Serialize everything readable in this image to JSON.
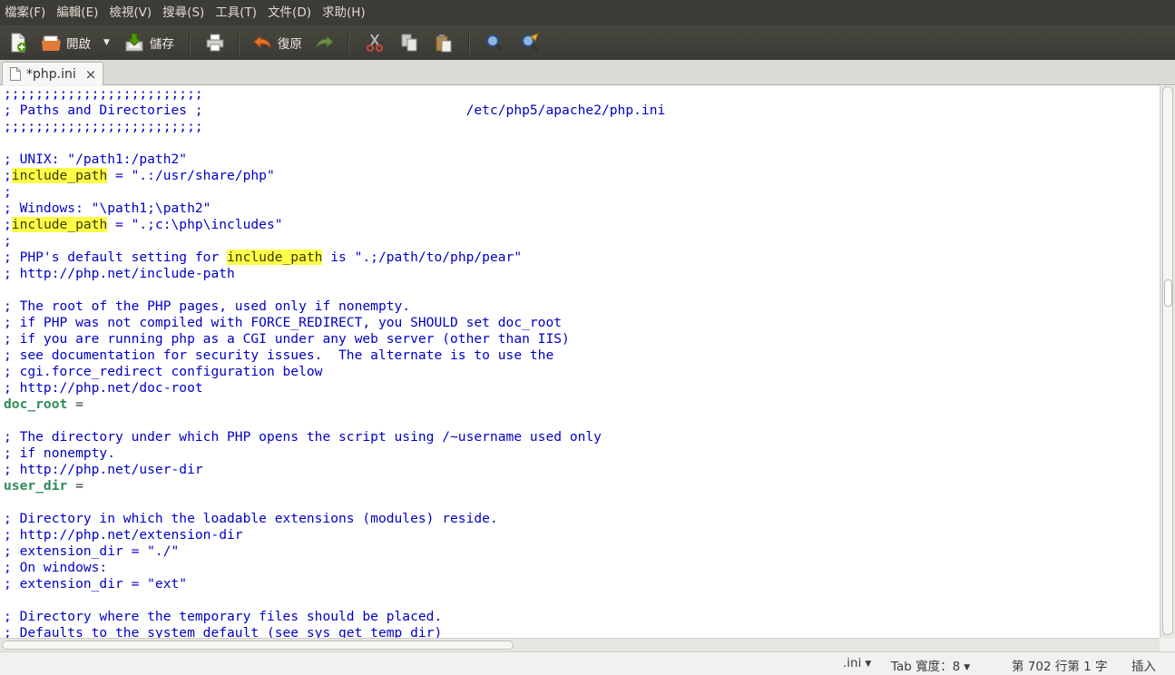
{
  "menu": [
    "檔案(F)",
    "編輯(E)",
    "檢視(V)",
    "搜尋(S)",
    "工具(T)",
    "文件(D)",
    "求助(H)"
  ],
  "toolbar": {
    "open_label": "開啟",
    "save_label": "儲存",
    "undo_label": "復原",
    "icons": [
      "new-document-icon",
      "open-folder-icon",
      "dropdown-arrow-icon",
      "save-icon",
      "print-icon",
      "undo-icon",
      "redo-icon",
      "cut-icon",
      "copy-icon",
      "paste-icon",
      "search-icon",
      "search-replace-icon"
    ]
  },
  "tab": {
    "title": "*php.ini",
    "close": "×"
  },
  "editor": {
    "lines": [
      [
        {
          "t": ";;;;;;;;;;;;;;;;;;;;;;;;;"
        }
      ],
      [
        {
          "t": "; Paths and Directories ;"
        },
        {
          "t": "                                 "
        },
        {
          "t": "/etc/php5/apache2/php.ini"
        }
      ],
      [
        {
          "t": ";;;;;;;;;;;;;;;;;;;;;;;;;"
        }
      ],
      [
        {
          "t": ""
        }
      ],
      [
        {
          "t": "; UNIX: \"/path1:/path2\""
        }
      ],
      [
        {
          "t": ";"
        },
        {
          "t": "include_path",
          "c": "hl"
        },
        {
          "t": " = \".:/usr/share/php\""
        }
      ],
      [
        {
          "t": ";"
        }
      ],
      [
        {
          "t": "; Windows: \"\\path1;\\path2\""
        }
      ],
      [
        {
          "t": ";"
        },
        {
          "t": "include_path",
          "c": "hl"
        },
        {
          "t": " = \".;c:\\php\\includes\""
        }
      ],
      [
        {
          "t": ";"
        }
      ],
      [
        {
          "t": "; PHP's default setting for "
        },
        {
          "t": "include_path",
          "c": "hl"
        },
        {
          "t": " is \".;/path/to/php/pear\""
        }
      ],
      [
        {
          "t": "; http://php.net/include-path"
        }
      ],
      [
        {
          "t": ""
        }
      ],
      [
        {
          "t": "; The root of the PHP pages, used only if nonempty."
        }
      ],
      [
        {
          "t": "; if PHP was not compiled with FORCE_REDIRECT, you SHOULD set doc_root"
        }
      ],
      [
        {
          "t": "; if you are running php as a CGI under any web server (other than IIS)"
        }
      ],
      [
        {
          "t": "; see documentation for security issues.  The alternate is to use the"
        }
      ],
      [
        {
          "t": "; cgi.force_redirect configuration below"
        }
      ],
      [
        {
          "t": "; http://php.net/doc-root"
        }
      ],
      [
        {
          "t": "doc_root",
          "c": "key"
        },
        {
          "t": " =",
          "c": "plain"
        }
      ],
      [
        {
          "t": ""
        }
      ],
      [
        {
          "t": "; The directory under which PHP opens the script using /~username used only"
        }
      ],
      [
        {
          "t": "; if nonempty."
        }
      ],
      [
        {
          "t": "; http://php.net/user-dir"
        }
      ],
      [
        {
          "t": "user_dir",
          "c": "key"
        },
        {
          "t": " =",
          "c": "plain"
        }
      ],
      [
        {
          "t": ""
        }
      ],
      [
        {
          "t": "; Directory in which the loadable extensions (modules) reside."
        }
      ],
      [
        {
          "t": "; http://php.net/extension-dir"
        }
      ],
      [
        {
          "t": "; extension_dir = \"./\""
        }
      ],
      [
        {
          "t": "; On windows:"
        }
      ],
      [
        {
          "t": "; extension_dir = \"ext\""
        }
      ],
      [
        {
          "t": ""
        }
      ],
      [
        {
          "t": "; Directory where the temporary files should be placed."
        }
      ],
      [
        {
          "t": "; Defaults to the system default (see sys_get_temp_dir)"
        }
      ]
    ]
  },
  "status": {
    "language": ".ini",
    "tab_width": "Tab 寬度：8",
    "position": "第 702 行第 1 字",
    "mode": "插入"
  },
  "colors": {
    "comment": "#0000c7",
    "key": "#2e8b57",
    "highlight": "#ffff4a",
    "menubar": "#3c3b37"
  }
}
